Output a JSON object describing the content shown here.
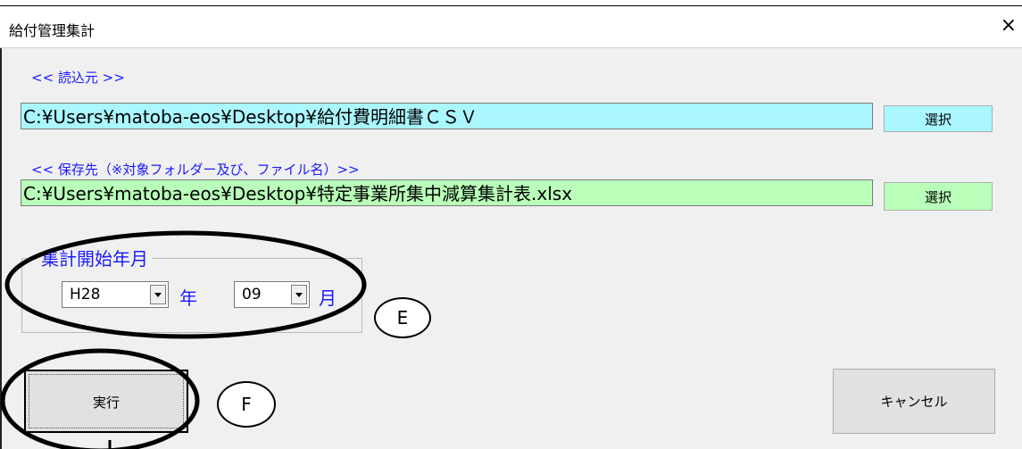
{
  "window": {
    "title": "給付管理集計",
    "close_glyph": "×"
  },
  "source": {
    "label": "<< 読込元 >>",
    "path": "C:¥Users¥matoba-eos¥Desktop¥給付費明細書ＣＳＶ",
    "button": "選択",
    "field_color": "#aaf7ff"
  },
  "destination": {
    "label": "<< 保存先（※対象フォルダー及び、ファイル名）>>",
    "path": "C:¥Users¥matoba-eos¥Desktop¥特定事業所集中減算集計表.xlsx",
    "button": "選択",
    "field_color": "#b9ffb9"
  },
  "period": {
    "group_label": "集計開始年月",
    "year_value": "H28",
    "year_unit": "年",
    "month_value": "09",
    "month_unit": "月"
  },
  "actions": {
    "execute": "実行",
    "cancel": "キャンセル"
  },
  "annotations": {
    "e": "E",
    "f": "F"
  }
}
